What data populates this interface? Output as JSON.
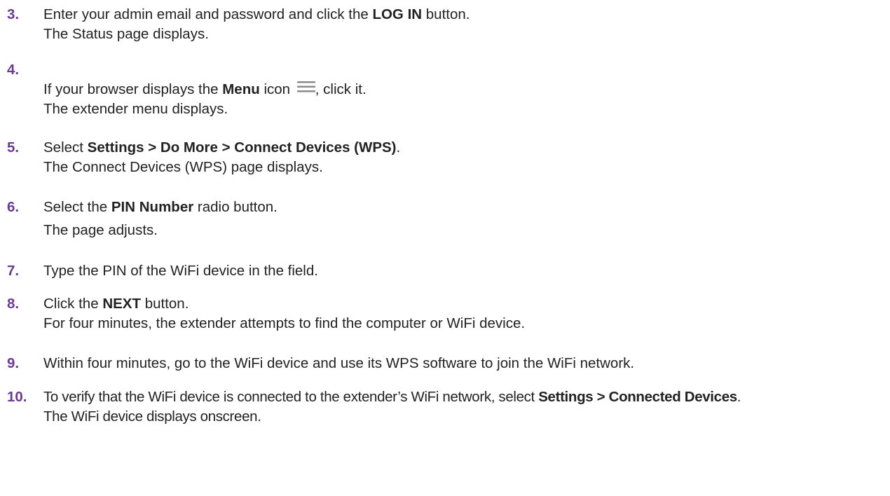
{
  "steps": [
    {
      "number": "3.",
      "line1": {
        "pre": "Enter your admin email and password and click the ",
        "bold": "LOG IN",
        "post": " button."
      },
      "line2": "The Status page displays."
    },
    {
      "number": "4.",
      "line1": {
        "pre": "If your browser displays the ",
        "bold": "Menu",
        "mid": " icon ",
        "post": ", click it."
      },
      "icon": "menu-icon",
      "line2": "The extender menu displays."
    },
    {
      "number": "5.",
      "line1": {
        "pre": "Select ",
        "bold": "Settings > Do More > Connect Devices (WPS)",
        "post": "."
      },
      "line2": "The Connect Devices (WPS) page displays."
    },
    {
      "number": "6.",
      "line1": {
        "pre": "Select the ",
        "bold": "PIN Number",
        "post": " radio button."
      },
      "line2": "The page adjusts."
    },
    {
      "number": "7.",
      "line1": {
        "pre": "Type the PIN of the WiFi device in the field."
      }
    },
    {
      "number": "8.",
      "line1": {
        "pre": "Click the ",
        "bold": "NEXT",
        "post": " button."
      },
      "line2": "For four minutes, the extender attempts to find the computer or WiFi device."
    },
    {
      "number": "9.",
      "line1": {
        "pre": "Within four minutes, go to the WiFi device and use its WPS software to join the WiFi network."
      }
    },
    {
      "number": "10.",
      "line1": {
        "pre": "To verify that the WiFi device is connected to the extender’s WiFi network, select ",
        "bold": "Settings > Connected Devices",
        "post": "."
      },
      "line2": "The WiFi device displays onscreen."
    }
  ]
}
